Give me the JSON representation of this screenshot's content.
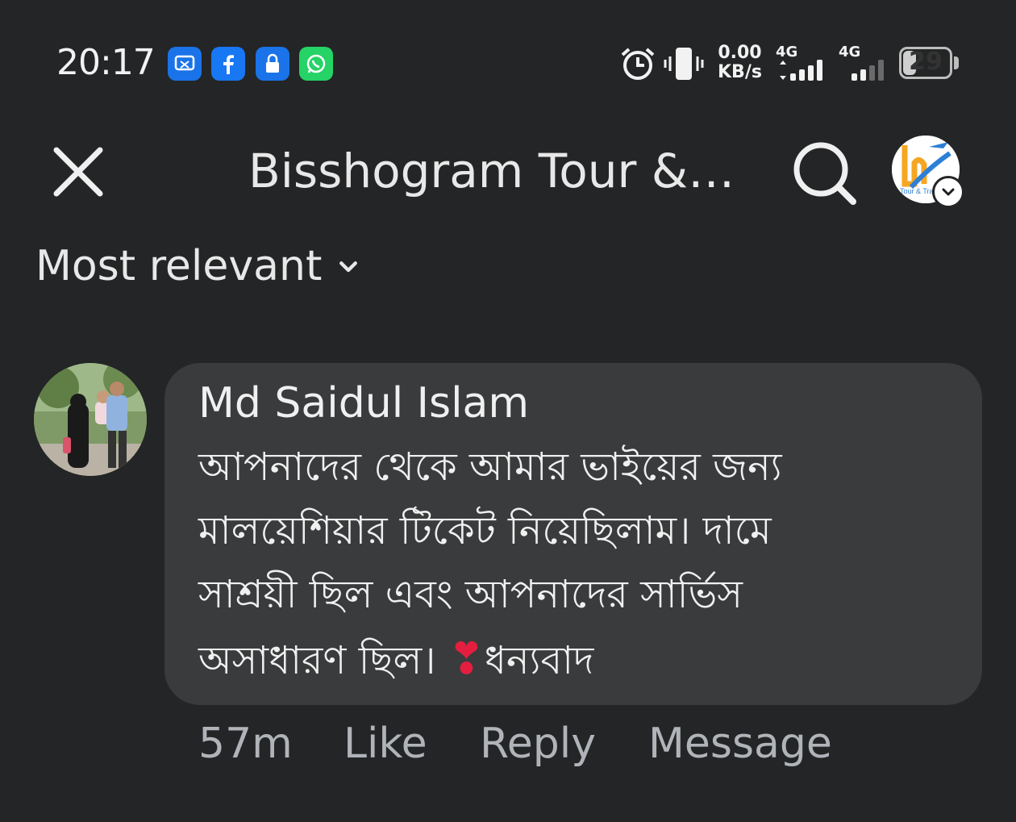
{
  "status_bar": {
    "time": "20:17",
    "apps": [
      "screenshot-app-icon",
      "facebook-icon",
      "lock-app-icon",
      "whatsapp-icon"
    ],
    "net_speed_value": "0.00",
    "net_speed_unit": "KB/s",
    "sim1_label": "4G",
    "sim2_label": "4G",
    "battery_level": "29",
    "battery_fraction": 0.29
  },
  "header": {
    "title": "Bisshogram Tour & Travels",
    "page_avatar_text": "Tour & Trav"
  },
  "sort": {
    "label": "Most relevant"
  },
  "comment": {
    "author": "Md Saidul Islam",
    "lines": [
      "আপনাদের থেকে  আমার ভাইয়ের জন্য",
      "মালয়েশিয়ার টিকেট নিয়েছিলাম। দামে",
      "সাশ্রয়ী ছিল এবং আপনাদের সার্ভিস",
      "অসাধারণ ছিল।"
    ],
    "heart": "❣",
    "line4_tail": "ধন্যবাদ",
    "time_ago": "57m",
    "like_label": "Like",
    "reply_label": "Reply",
    "message_label": "Message"
  },
  "colors": {
    "background": "#242526",
    "bubble": "#3a3b3c",
    "secondary_text": "#b0b3b8",
    "facebook_blue": "#1877f2",
    "whatsapp_green": "#25d366"
  }
}
